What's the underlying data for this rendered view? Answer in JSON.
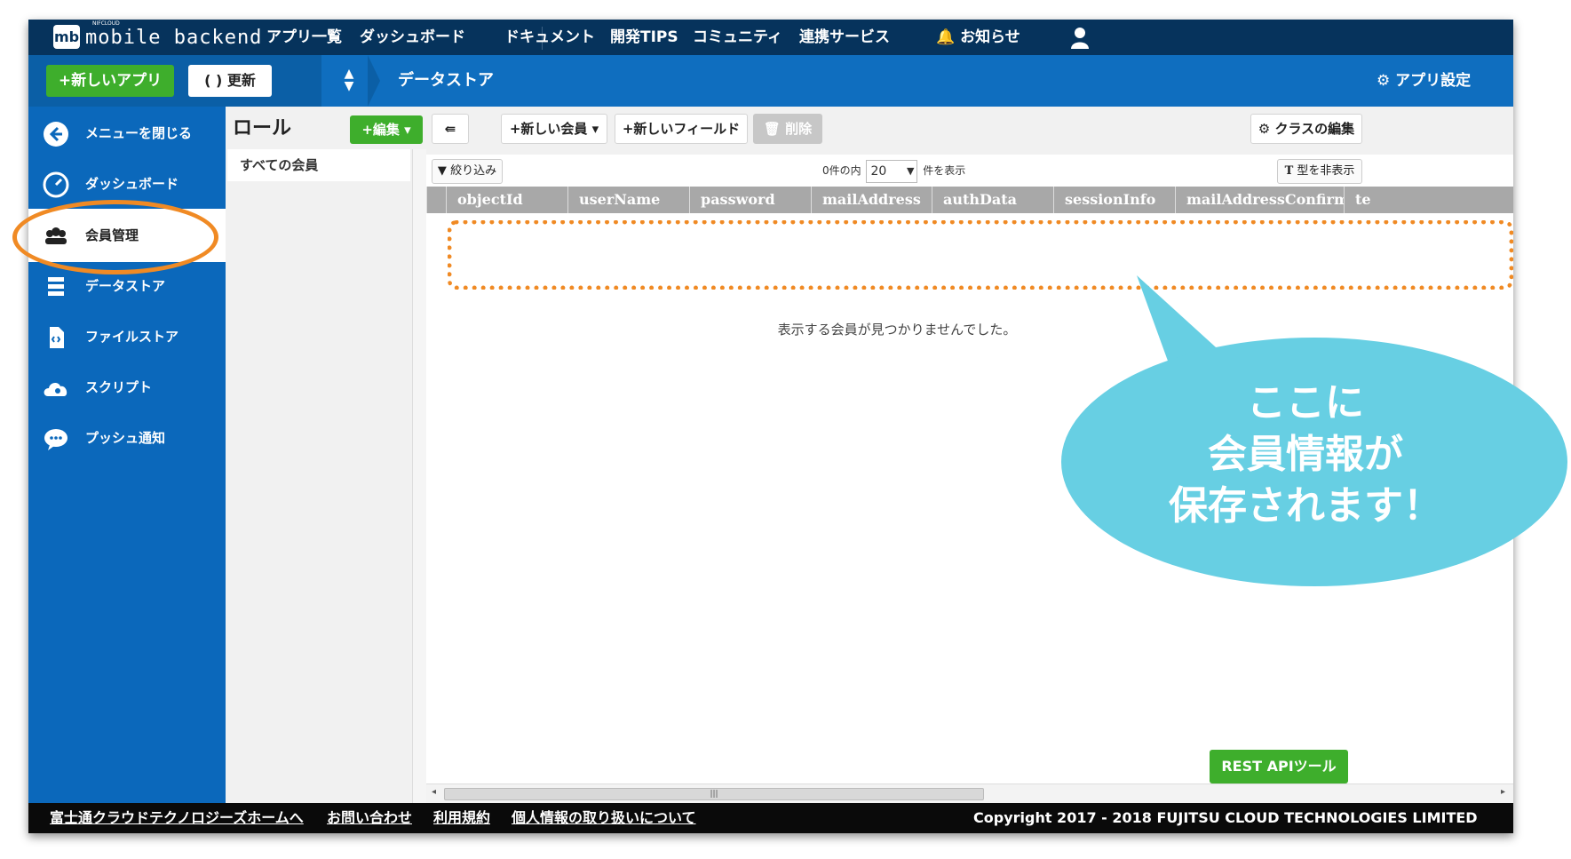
{
  "logo": {
    "small": "NIFCLOUD",
    "text": "mobile backend",
    "mark": "mb"
  },
  "topnav": {
    "items": [
      "アプリ一覧",
      "ダッシュボード",
      "ドキュメント",
      "開発TIPS",
      "コミュニティ",
      "連携サービス"
    ],
    "notifications": "お知らせ"
  },
  "subbar": {
    "new_app": "+新しいアプリ",
    "refresh": "更新",
    "breadcrumb": "データストア",
    "app_settings": "アプリ設定"
  },
  "sidebar": {
    "items": [
      {
        "label": "メニューを閉じる",
        "icon": "arrow-left-icon"
      },
      {
        "label": "ダッシュボード",
        "icon": "gauge-icon"
      },
      {
        "label": "会員管理",
        "icon": "users-icon"
      },
      {
        "label": "データストア",
        "icon": "database-icon"
      },
      {
        "label": "ファイルストア",
        "icon": "file-icon"
      },
      {
        "label": "スクリプト",
        "icon": "cloud-gear-icon"
      },
      {
        "label": "プッシュ通知",
        "icon": "chat-bubble-icon"
      }
    ],
    "active_index": 2
  },
  "roles": {
    "title": "ロール",
    "edit": "+編集",
    "all_members": "すべての会員"
  },
  "toolbar": {
    "new_member": "+新しい会員",
    "new_field": "+新しいフィールド",
    "delete": "削除",
    "class_edit": "クラスの編集"
  },
  "filterbar": {
    "filter": "絞り込み",
    "count_prefix": "0件の内",
    "page_size": "20",
    "count_suffix": "件を表示",
    "hide_types": "型を非表示"
  },
  "grid": {
    "columns": [
      "objectId",
      "userName",
      "password",
      "mailAddress",
      "authData",
      "sessionInfo",
      "mailAddressConfirm",
      "te"
    ],
    "empty_message": "表示する会員が見つかりませんでした。"
  },
  "rest_tool": "REST APIツール",
  "footer": {
    "links": [
      "富士通クラウドテクノロジーズホームへ",
      "お問い合わせ",
      "利用規約",
      "個人情報の取り扱いについて"
    ],
    "copyright": "Copyright 2017 - 2018 FUJITSU CLOUD TECHNOLOGIES LIMITED"
  },
  "callout": {
    "lines": [
      "ここに",
      "会員情報が",
      "保存されます！"
    ],
    "color": "#67cfe3"
  },
  "colors": {
    "nav": "#06335c",
    "subbar": "#0f6ebf",
    "sidebar": "#0b68bb",
    "accent_green": "#3eae2c",
    "highlight": "#f08a24"
  }
}
